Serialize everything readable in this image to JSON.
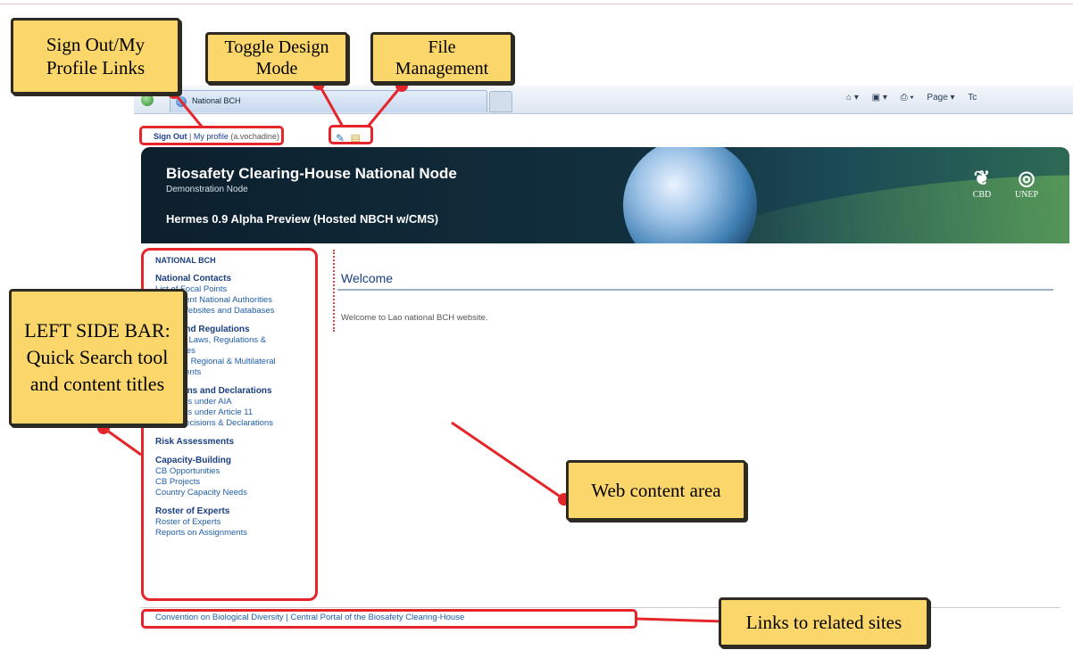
{
  "browser": {
    "tab_title": "National BCH",
    "tools": [
      "⌂ ▾",
      "▣ ▾",
      "⎙ ▾",
      "Page ▾",
      "Tc"
    ]
  },
  "account": {
    "sign_out": "Sign Out",
    "separator": "|",
    "my_profile": "My profile",
    "username": "(a.vochadine)"
  },
  "banner": {
    "title": "Biosafety Clearing-House National Node",
    "subtitle": "Demonstration Node",
    "version": "Hermes 0.9 Alpha Preview (Hosted NBCH w/CMS)",
    "logo_cbd": "CBD",
    "logo_unep": "UNEP"
  },
  "sidebar": {
    "heading": "NATIONAL BCH",
    "sections": [
      {
        "title": "National Contacts",
        "items": [
          "List of Focal Points",
          "Competent National Authorities",
          "List of Websites and Databases"
        ]
      },
      {
        "title": "Laws and Regulations",
        "items": [
          "National Laws, Regulations &",
          "Guidelines",
          "Bilateral, Regional & Multilateral",
          "Agreements"
        ]
      },
      {
        "title": "Decisions and Declarations",
        "items": [
          "Decisions under AIA",
          "Decisions under Article 11",
          "Other Decisions & Declarations"
        ]
      },
      {
        "title": "Risk Assessments",
        "items": []
      },
      {
        "title": "Capacity-Building",
        "items": [
          "CB Opportunities",
          "CB Projects",
          "Country Capacity Needs"
        ]
      },
      {
        "title": "Roster of Experts",
        "items": [
          "Roster of Experts",
          "Reports on Assignments"
        ]
      }
    ]
  },
  "content": {
    "title": "Welcome",
    "text": "Welcome to Lao national BCH website."
  },
  "footer": {
    "links": "Convention on Biological Diversity | Central Portal of the Biosafety Clearing-House"
  },
  "annotations": {
    "signout_profile": "Sign Out/My Profile Links",
    "toggle_design": "Toggle Design Mode",
    "file_management": "File Management",
    "left_sidebar": "LEFT SIDE BAR: Quick Search tool and content titles",
    "web_content": "Web content area",
    "related_links": "Links to related sites"
  },
  "colors": {
    "annotation_fill": "#fbd66b",
    "annotation_marker": "#e4262b",
    "link": "#1f5ea8"
  }
}
